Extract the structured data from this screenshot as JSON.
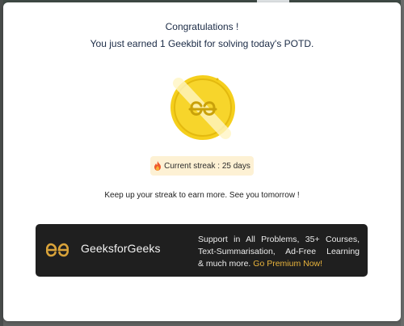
{
  "background": {
    "overlay_color": "#5f6160"
  },
  "modal": {
    "title": "Congratulations !",
    "subtitle": "You just earned 1 Geekbit for solving today's POTD.",
    "coin_icon": "geekbit-coin-icon",
    "streak": {
      "icon": "fire-icon",
      "text": "Current streak : 25 days"
    },
    "message": "Keep up your streak to earn more. See you tomorrow !",
    "banner": {
      "logo_icon": "geeksforgeeks-logo-icon",
      "brand_name": "GeeksforGeeks",
      "description_lines": [
        "Support in All Problems, 35+ Courses,",
        "Text-Summarisation, Ad-Free Learning",
        "& much more. "
      ],
      "cta_label": "Go Premium Now!"
    }
  },
  "colors": {
    "title_text": "#1b2b46",
    "coin_gold": "#f5cf1c",
    "streak_bg": "#fdf1d4",
    "banner_bg": "#1f1f1f",
    "cta_gold": "#e9b43c"
  }
}
